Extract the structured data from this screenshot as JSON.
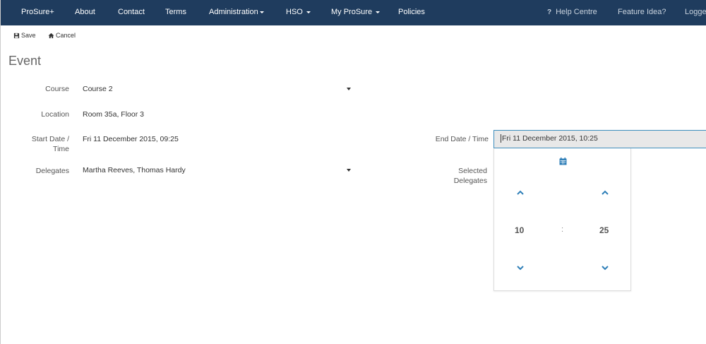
{
  "navbar": {
    "items": [
      {
        "label": "ProSure+",
        "dropdown": false
      },
      {
        "label": "About",
        "dropdown": false
      },
      {
        "label": "Contact",
        "dropdown": false
      },
      {
        "label": "Terms",
        "dropdown": false
      },
      {
        "label": "Administration",
        "dropdown": true
      },
      {
        "label": "HSO",
        "dropdown": true
      },
      {
        "label": "My ProSure",
        "dropdown": true
      },
      {
        "label": "Policies",
        "dropdown": false
      }
    ],
    "help": "Help Centre",
    "feature": "Feature Idea?",
    "logged": "Logged"
  },
  "toolbar": {
    "save_label": "Save",
    "cancel_label": "Cancel"
  },
  "page": {
    "title": "Event"
  },
  "form": {
    "course_label": "Course",
    "course_value": "Course 2",
    "location_label": "Location",
    "location_value": "Room 35a, Floor 3",
    "start_label_1": "Start Date /",
    "start_label_2": "Time",
    "start_value": "Fri 11 December 2015, 09:25",
    "delegates_label": "Delegates",
    "delegates_value": "Martha Reeves, Thomas Hardy",
    "end_label": "End Date / Time",
    "end_value": "Fri 11 December 2015, 10:25",
    "selected_label_1": "Selected",
    "selected_label_2": "Delegates"
  },
  "timepicker": {
    "hour": "10",
    "separator": ":",
    "minute": "25"
  },
  "colors": {
    "navbar": "#1f3c5e",
    "accent": "#2f7fb8"
  }
}
